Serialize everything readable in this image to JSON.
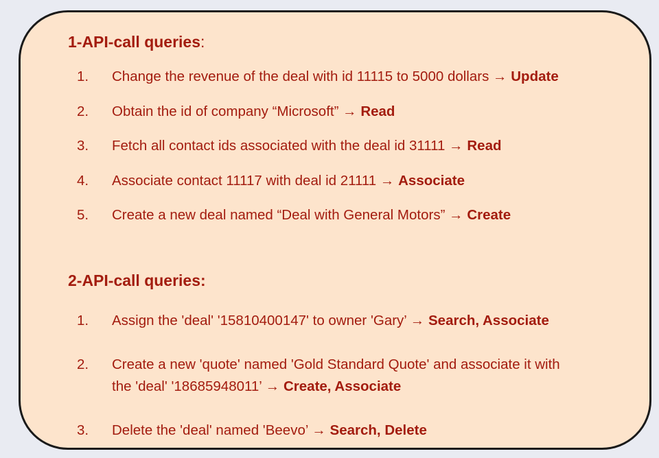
{
  "colors": {
    "background": "#e9ebf2",
    "card_fill": "#fde4cc",
    "card_border": "#1a1a1a",
    "text": "#a31c0f"
  },
  "arrow": "→",
  "sections": [
    {
      "title": "1-API-call queries",
      "colon": ":",
      "items": [
        {
          "num": "1.",
          "text": "Change the revenue of the deal with id 11115 to 5000 dollars",
          "ops": "Update"
        },
        {
          "num": "2.",
          "text": "Obtain the id of company “Microsoft”",
          "ops": "Read"
        },
        {
          "num": "3.",
          "text": "Fetch all contact ids associated with the deal id 31111",
          "ops": "Read"
        },
        {
          "num": "4.",
          "text": "Associate contact 11117 with deal id 21111",
          "ops": "Associate"
        },
        {
          "num": "5.",
          "text": "Create a new deal named “Deal with General Motors”",
          "ops": "Create"
        }
      ]
    },
    {
      "title": "2-API-call queries",
      "colon": ":",
      "items": [
        {
          "num": "1.",
          "text": "Assign the 'deal' '15810400147' to owner 'Gary’",
          "ops": "Search, Associate"
        },
        {
          "num": "2.",
          "text": "Create a new 'quote' named 'Gold Standard Quote' and associate it with",
          "text2": "the 'deal' '18685948011’",
          "ops": "Create, Associate"
        },
        {
          "num": "3.",
          "text": "Delete the 'deal' named 'Beevo’",
          "ops": "Search, Delete"
        }
      ]
    }
  ]
}
